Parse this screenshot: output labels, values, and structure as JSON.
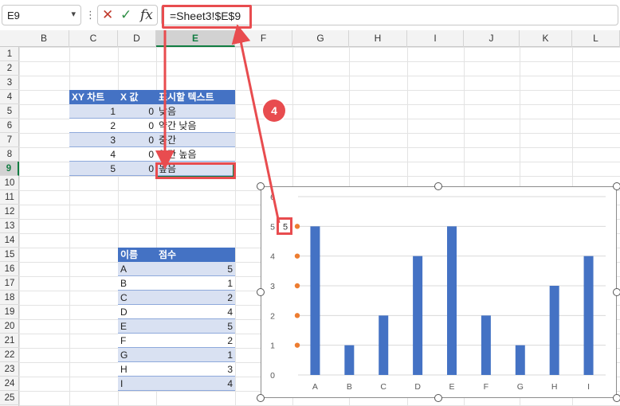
{
  "formula_bar": {
    "name_box": "E9",
    "separator": "⋮",
    "cancel_icon": "✕",
    "enter_icon": "✓",
    "fx_label": "fx",
    "formula": "=Sheet3!$E$9"
  },
  "columns": [
    "B",
    "C",
    "D",
    "E",
    "F",
    "G",
    "H",
    "I",
    "J",
    "K",
    "L"
  ],
  "rows": [
    "1",
    "2",
    "3",
    "4",
    "5",
    "6",
    "7",
    "8",
    "9",
    "10",
    "11",
    "12",
    "13",
    "14",
    "15",
    "16",
    "17",
    "18",
    "19",
    "20",
    "21",
    "22",
    "23",
    "24",
    "25"
  ],
  "selected_column": "E",
  "selected_row": "9",
  "xy_table": {
    "headers": [
      "XY 차트",
      "X 값",
      "표시할 텍스트"
    ],
    "rows": [
      {
        "xy": "1",
        "x": "0",
        "text": "낮음"
      },
      {
        "xy": "2",
        "x": "0",
        "text": "약간 낮음"
      },
      {
        "xy": "3",
        "x": "0",
        "text": "중간"
      },
      {
        "xy": "4",
        "x": "0",
        "text": "약간 높음"
      },
      {
        "xy": "5",
        "x": "0",
        "text": "높음"
      }
    ]
  },
  "score_table": {
    "headers": [
      "이름",
      "점수"
    ],
    "rows": [
      {
        "name": "A",
        "score": "5"
      },
      {
        "name": "B",
        "score": "1"
      },
      {
        "name": "C",
        "score": "2"
      },
      {
        "name": "D",
        "score": "4"
      },
      {
        "name": "E",
        "score": "5"
      },
      {
        "name": "F",
        "score": "2"
      },
      {
        "name": "G",
        "score": "1"
      },
      {
        "name": "H",
        "score": "3"
      },
      {
        "name": "I",
        "score": "4"
      }
    ]
  },
  "callout_number": "4",
  "colors": {
    "bar": "#4472c4",
    "marker": "#ed7d31",
    "highlight": "#e84c4f",
    "header_fill": "#4472c4",
    "band_fill": "#d9e1f2",
    "selection": "#107c41"
  },
  "chart_data": {
    "type": "bar",
    "categories": [
      "A",
      "B",
      "C",
      "D",
      "E",
      "F",
      "G",
      "H",
      "I"
    ],
    "values": [
      5,
      1,
      2,
      4,
      5,
      2,
      1,
      3,
      4
    ],
    "ylim": [
      0,
      6
    ],
    "yticks": [
      "0",
      "1",
      "2",
      "3",
      "4",
      "5",
      "6"
    ],
    "xy_series_y": [
      1,
      2,
      3,
      4,
      5
    ],
    "xy_series_x": [
      0,
      0,
      0,
      0,
      0
    ],
    "data_label": "5",
    "data_label_y": 5,
    "grid": true
  }
}
